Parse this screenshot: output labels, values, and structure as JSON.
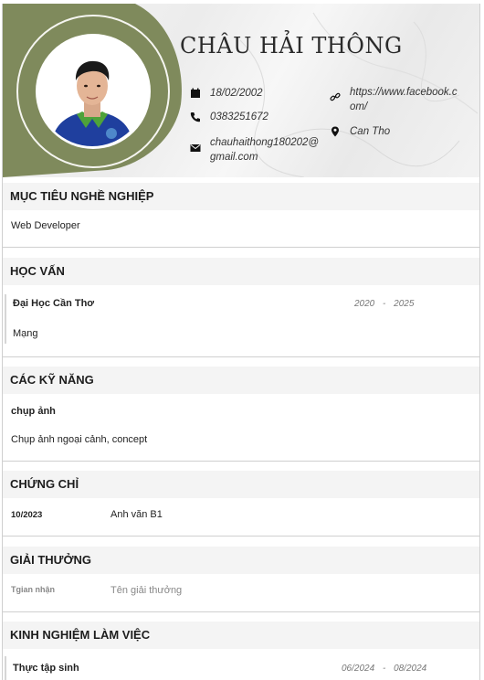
{
  "header": {
    "name": "CHÂU HẢI THÔNG",
    "birthday": "18/02/2002",
    "phone": "0383251672",
    "email_line1": "chauhaithong180202@",
    "email_line2": "gmail.com",
    "website_line1": "https://www.facebook.c",
    "website_line2": "om/",
    "location": "Can Tho",
    "accent_color": "#7f8a5c",
    "icons": [
      "calendar-icon",
      "phone-icon",
      "mail-icon",
      "link-icon",
      "location-pin-icon"
    ]
  },
  "objective": {
    "title": "MỤC TIÊU NGHỀ NGHIỆP",
    "text": "Web Developer"
  },
  "education": {
    "title": "HỌC VẤN",
    "school": "Đại Học Cần Thơ",
    "start": "2020",
    "separator": "-",
    "end": "2025",
    "major": "Mạng"
  },
  "skills": {
    "title": "CÁC KỸ NĂNG",
    "name": "chụp ảnh",
    "description": "Chụp ảnh ngoại cảnh, concept"
  },
  "certificates": {
    "title": "CHỨNG CHỈ",
    "date": "10/2023",
    "name": "Anh văn B1"
  },
  "awards": {
    "title": "GIẢI THƯỞNG",
    "date_placeholder": "Tgian nhận",
    "name_placeholder": "Tên giải thưởng"
  },
  "experience": {
    "title": "KINH NGHIỆM LÀM VIỆC",
    "position": "Thực tập sinh",
    "start": "06/2024",
    "separator": "-",
    "end": "08/2024"
  }
}
